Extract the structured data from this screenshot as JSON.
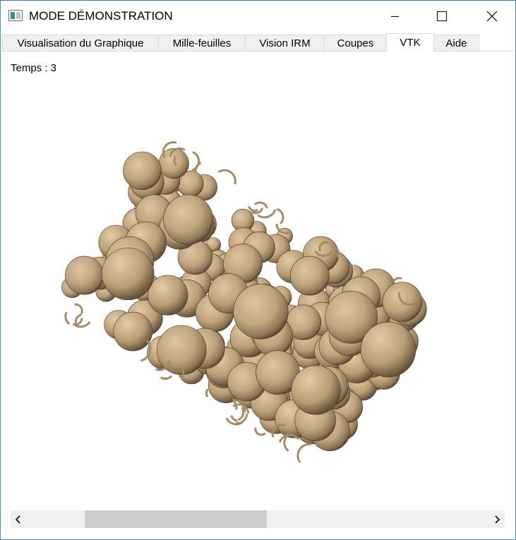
{
  "window": {
    "title": "MODE DÉMONSTRATION",
    "icon": "app-window-icon",
    "controls": [
      "minimize-icon",
      "maximize-icon",
      "close-icon"
    ]
  },
  "tabs": [
    {
      "label": "Visualisation du Graphique",
      "active": false
    },
    {
      "label": "Mille-feuilles",
      "active": false
    },
    {
      "label": "Vision IRM",
      "active": false
    },
    {
      "label": "Coupes",
      "active": false
    },
    {
      "label": "VTK",
      "active": true
    },
    {
      "label": "Aide",
      "active": false
    }
  ],
  "content": {
    "temps_label": "Temps : 3",
    "render_view": "vtk-particle-cylinder-render",
    "particle_color": "#c4ad87"
  },
  "scrollbar": {
    "icons": [
      "chevron-left-icon",
      "chevron-right-icon"
    ]
  }
}
